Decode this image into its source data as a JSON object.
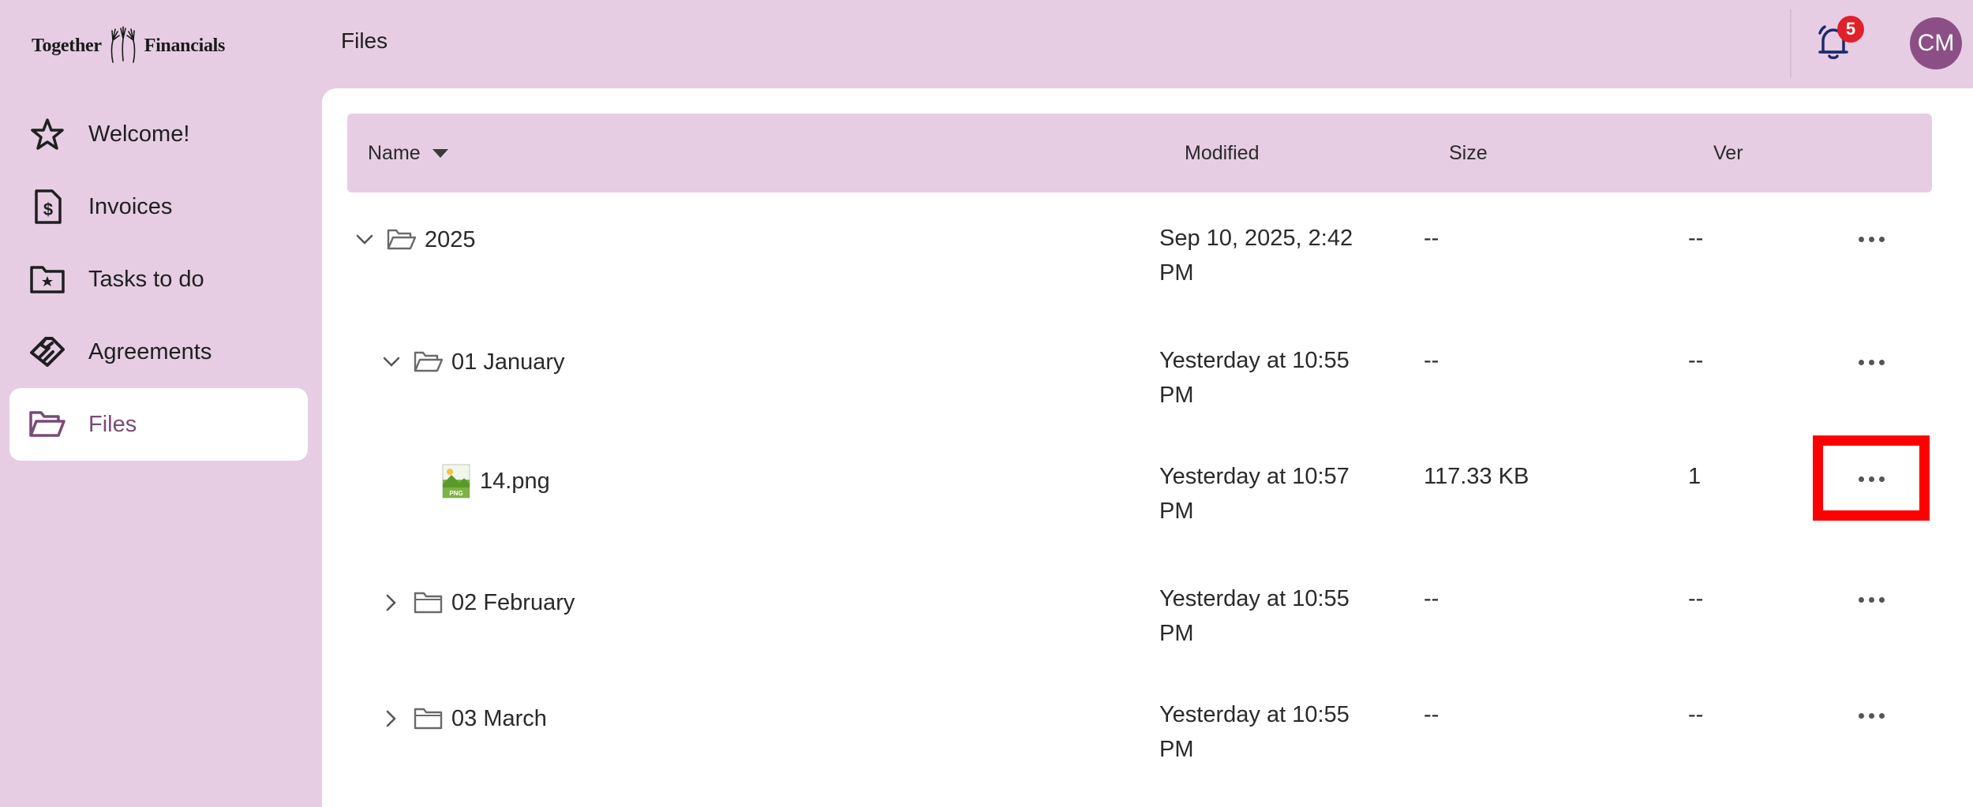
{
  "brand": {
    "logo_left": "Together",
    "logo_right": "Financials"
  },
  "header": {
    "title": "Files",
    "notifications_count": "5",
    "user_initials": "CM"
  },
  "sidebar": {
    "items": [
      {
        "label": "Welcome!",
        "icon": "star-icon",
        "active": false
      },
      {
        "label": "Invoices",
        "icon": "invoice-icon",
        "active": false
      },
      {
        "label": "Tasks to do",
        "icon": "task-folder-icon",
        "active": false
      },
      {
        "label": "Agreements",
        "icon": "handshake-icon",
        "active": false
      },
      {
        "label": "Files",
        "icon": "folder-open-icon",
        "active": true
      }
    ]
  },
  "table": {
    "columns": {
      "name": "Name",
      "modified": "Modified",
      "size": "Size",
      "ver": "Ver"
    },
    "rows": [
      {
        "name": "2025",
        "type": "folder",
        "expanded": true,
        "modified_line1": "Sep 10, 2025, 2:42",
        "modified_line2": "PM",
        "size": "--",
        "ver": "--"
      },
      {
        "name": "01 January",
        "type": "folder",
        "expanded": true,
        "modified_line1": "Yesterday at 10:55",
        "modified_line2": "PM",
        "size": "--",
        "ver": "--"
      },
      {
        "name": "14.png",
        "type": "png-file",
        "modified_line1": "Yesterday at 10:57",
        "modified_line2": "PM",
        "size": "117.33 KB",
        "ver": "1"
      },
      {
        "name": "02 February",
        "type": "folder",
        "expanded": false,
        "modified_line1": "Yesterday at 10:55",
        "modified_line2": "PM",
        "size": "--",
        "ver": "--"
      },
      {
        "name": "03 March",
        "type": "folder",
        "expanded": false,
        "modified_line1": "Yesterday at 10:55",
        "modified_line2": "PM",
        "size": "--",
        "ver": "--"
      }
    ]
  },
  "colors": {
    "background": "#e6cde4",
    "accent": "#7a4a78",
    "avatar": "#8b4f85",
    "badge": "#e0202a",
    "highlight": "#ff0000"
  }
}
